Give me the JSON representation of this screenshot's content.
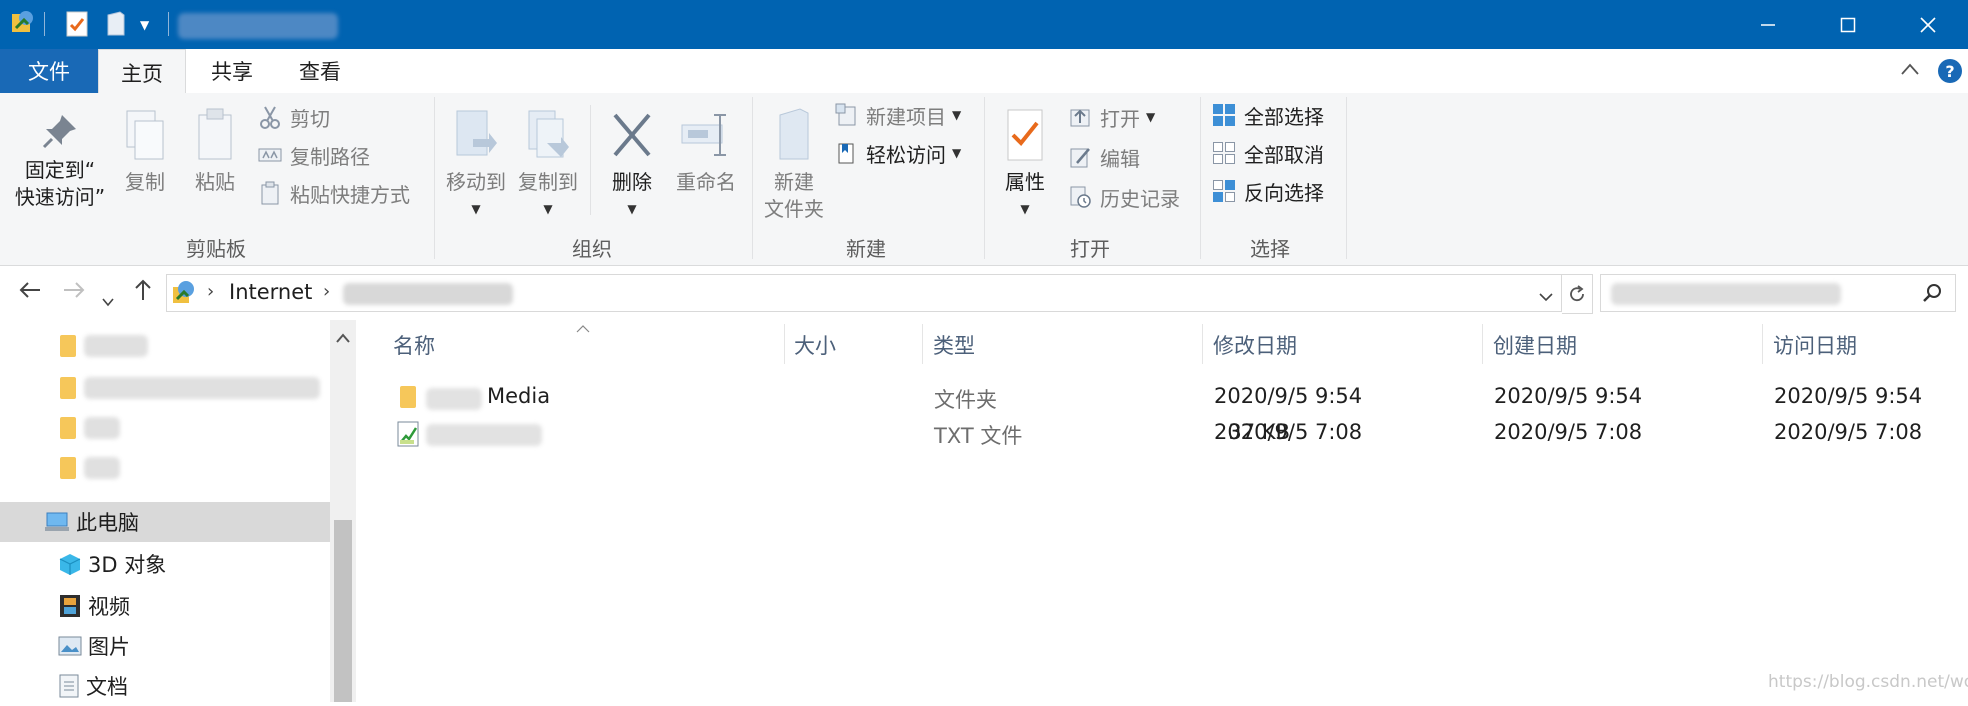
{
  "tabs": [
    {
      "label": "文件"
    },
    {
      "label": "主页"
    },
    {
      "label": "共享"
    },
    {
      "label": "查看"
    }
  ],
  "ribbon": {
    "clipboard": {
      "group_label": "剪贴板",
      "pin_label": "固定到“\n快速访问”",
      "copy_label": "复制",
      "paste_label": "粘贴",
      "cut_label": "剪切",
      "copy_path_label": "复制路径",
      "paste_shortcut_label": "粘贴快捷方式"
    },
    "organize": {
      "group_label": "组织",
      "move_to_label": "移动到",
      "copy_to_label": "复制到",
      "delete_label": "删除",
      "rename_label": "重命名"
    },
    "new": {
      "group_label": "新建",
      "new_folder_label": "新建\n文件夹",
      "new_item_label": "新建项目",
      "easy_access_label": "轻松访问"
    },
    "open": {
      "group_label": "打开",
      "properties_label": "属性",
      "open_label": "打开",
      "edit_label": "编辑",
      "history_label": "历史记录"
    },
    "select": {
      "group_label": "选择",
      "select_all_label": "全部选择",
      "select_none_label": "全部取消",
      "invert_label": "反向选择"
    }
  },
  "address": {
    "segment": "Internet"
  },
  "nav": {
    "this_pc": "此电脑",
    "items": [
      {
        "label": "3D 对象"
      },
      {
        "label": "视频"
      },
      {
        "label": "图片"
      },
      {
        "label": "文档"
      }
    ]
  },
  "columns": [
    "名称",
    "大小",
    "类型",
    "修改日期",
    "创建日期",
    "访问日期"
  ],
  "files": [
    {
      "name_suffix": "Media",
      "size": "",
      "type": "文件夹",
      "modified": "2020/9/5 9:54",
      "created": "2020/9/5 9:54",
      "accessed": "2020/9/5 9:54"
    },
    {
      "name_suffix": "",
      "size": "37 KB",
      "type": "TXT 文件",
      "modified": "2020/9/5 7:08",
      "created": "2020/9/5 7:08",
      "accessed": "2020/9/5 7:08"
    }
  ],
  "watermark": "https://blog.csdn.net/wojuzi",
  "colors": {
    "titlebar": "#0063b1",
    "file_tab": "#1969b6",
    "ribbon_bg": "#f5f6f7",
    "selection": "#d9d9d9"
  }
}
